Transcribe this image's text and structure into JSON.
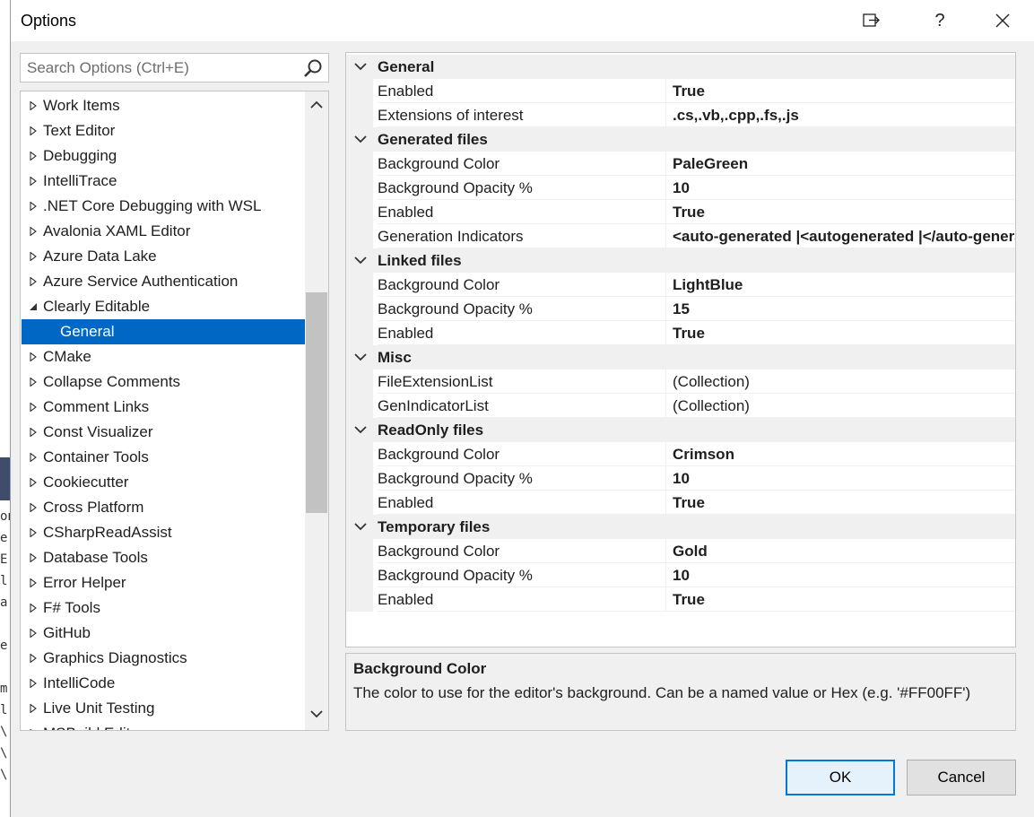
{
  "window": {
    "title": "Options"
  },
  "titlebar": {
    "pin_glyph": "⇨",
    "help_glyph": "?",
    "close_glyph": "✕"
  },
  "search": {
    "placeholder": "Search Options (Ctrl+E)"
  },
  "tree": {
    "items": [
      {
        "label": "Work Items",
        "state": "collapsed"
      },
      {
        "label": "Text Editor",
        "state": "collapsed"
      },
      {
        "label": "Debugging",
        "state": "collapsed"
      },
      {
        "label": "IntelliTrace",
        "state": "collapsed"
      },
      {
        "label": ".NET Core Debugging with WSL",
        "state": "collapsed"
      },
      {
        "label": "Avalonia XAML Editor",
        "state": "collapsed"
      },
      {
        "label": "Azure Data Lake",
        "state": "collapsed"
      },
      {
        "label": "Azure Service Authentication",
        "state": "collapsed"
      },
      {
        "label": "Clearly Editable",
        "state": "expanded"
      },
      {
        "label": "General",
        "state": "child-selected"
      },
      {
        "label": "CMake",
        "state": "collapsed"
      },
      {
        "label": "Collapse Comments",
        "state": "collapsed"
      },
      {
        "label": "Comment Links",
        "state": "collapsed"
      },
      {
        "label": "Const Visualizer",
        "state": "collapsed"
      },
      {
        "label": "Container Tools",
        "state": "collapsed"
      },
      {
        "label": "Cookiecutter",
        "state": "collapsed"
      },
      {
        "label": "Cross Platform",
        "state": "collapsed"
      },
      {
        "label": "CSharpReadAssist",
        "state": "collapsed"
      },
      {
        "label": "Database Tools",
        "state": "collapsed"
      },
      {
        "label": "Error Helper",
        "state": "collapsed"
      },
      {
        "label": "F# Tools",
        "state": "collapsed"
      },
      {
        "label": "GitHub",
        "state": "collapsed"
      },
      {
        "label": "Graphics Diagnostics",
        "state": "collapsed"
      },
      {
        "label": "IntelliCode",
        "state": "collapsed"
      },
      {
        "label": "Live Unit Testing",
        "state": "collapsed"
      },
      {
        "label": "MSBuild Editor",
        "state": "collapsed"
      }
    ]
  },
  "properties": [
    {
      "category": "General",
      "props": [
        {
          "name": "Enabled",
          "value": "True",
          "bold": true
        },
        {
          "name": "Extensions of interest",
          "value": ".cs,.vb,.cpp,.fs,.js",
          "bold": true
        }
      ]
    },
    {
      "category": "Generated files",
      "props": [
        {
          "name": "Background Color",
          "value": "PaleGreen",
          "bold": true
        },
        {
          "name": "Background Opacity %",
          "value": "10",
          "bold": true
        },
        {
          "name": "Enabled",
          "value": "True",
          "bold": true
        },
        {
          "name": "Generation Indicators",
          "value": "<auto-generated |<autogenerated |</auto-generated",
          "bold": true
        }
      ]
    },
    {
      "category": "Linked files",
      "props": [
        {
          "name": "Background Color",
          "value": "LightBlue",
          "bold": true
        },
        {
          "name": "Background Opacity %",
          "value": "15",
          "bold": true
        },
        {
          "name": "Enabled",
          "value": "True",
          "bold": true
        }
      ]
    },
    {
      "category": "Misc",
      "props": [
        {
          "name": "FileExtensionList",
          "value": "(Collection)",
          "bold": false
        },
        {
          "name": "GenIndicatorList",
          "value": "(Collection)",
          "bold": false
        }
      ]
    },
    {
      "category": "ReadOnly files",
      "props": [
        {
          "name": "Background Color",
          "value": "Crimson",
          "bold": true
        },
        {
          "name": "Background Opacity %",
          "value": "10",
          "bold": true
        },
        {
          "name": "Enabled",
          "value": "True",
          "bold": true
        }
      ]
    },
    {
      "category": "Temporary files",
      "props": [
        {
          "name": "Background Color",
          "value": "Gold",
          "bold": true
        },
        {
          "name": "Background Opacity %",
          "value": "10",
          "bold": true
        },
        {
          "name": "Enabled",
          "value": "True",
          "bold": true
        }
      ]
    }
  ],
  "description": {
    "title": "Background Color",
    "text": "The color to use for the editor's background. Can be a named value or Hex (e.g. '#FF00FF')"
  },
  "buttons": {
    "ok": "OK",
    "cancel": "Cancel"
  },
  "background_editor_chars": [
    "on",
    "e",
    "E",
    "l",
    "a",
    "e",
    "m",
    "l",
    "\\",
    "\\",
    "\\"
  ],
  "colors": {
    "selection": "#0068c4",
    "default_button_border": "#0078d7",
    "dialog_bg": "#f0f0f0"
  }
}
